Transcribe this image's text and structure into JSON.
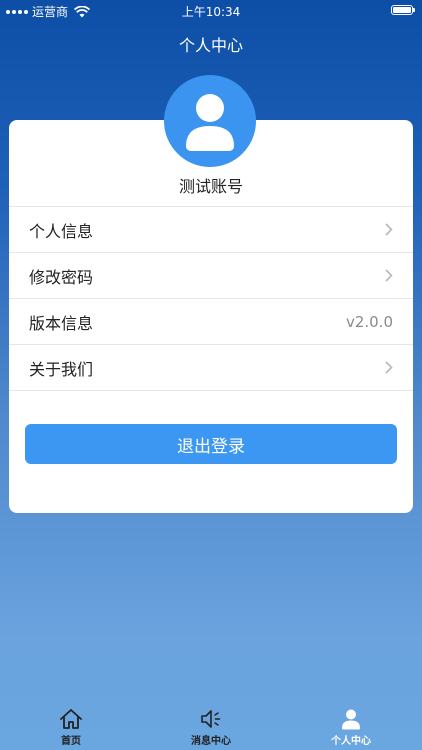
{
  "status_bar": {
    "carrier": "运营商",
    "time": "上午10:34"
  },
  "page": {
    "title": "个人中心"
  },
  "profile": {
    "account_name": "测试账号",
    "avatar_icon": "user-avatar-icon"
  },
  "menu": {
    "items": [
      {
        "label": "个人信息",
        "icon": "chevron-right-icon"
      },
      {
        "label": "修改密码",
        "icon": "chevron-right-icon"
      },
      {
        "label": "版本信息",
        "value": "v2.0.0"
      },
      {
        "label": "关于我们",
        "icon": "chevron-right-icon"
      }
    ]
  },
  "actions": {
    "logout_label": "退出登录"
  },
  "tabbar": {
    "tabs": [
      {
        "label": "首页",
        "icon": "home-icon"
      },
      {
        "label": "消息中心",
        "icon": "speaker-icon"
      },
      {
        "label": "个人中心",
        "icon": "user-icon",
        "active": true
      }
    ]
  },
  "colors": {
    "accent": "#3c97f2",
    "header_blue": "#0d4ea6",
    "card_bg": "#ffffff"
  }
}
